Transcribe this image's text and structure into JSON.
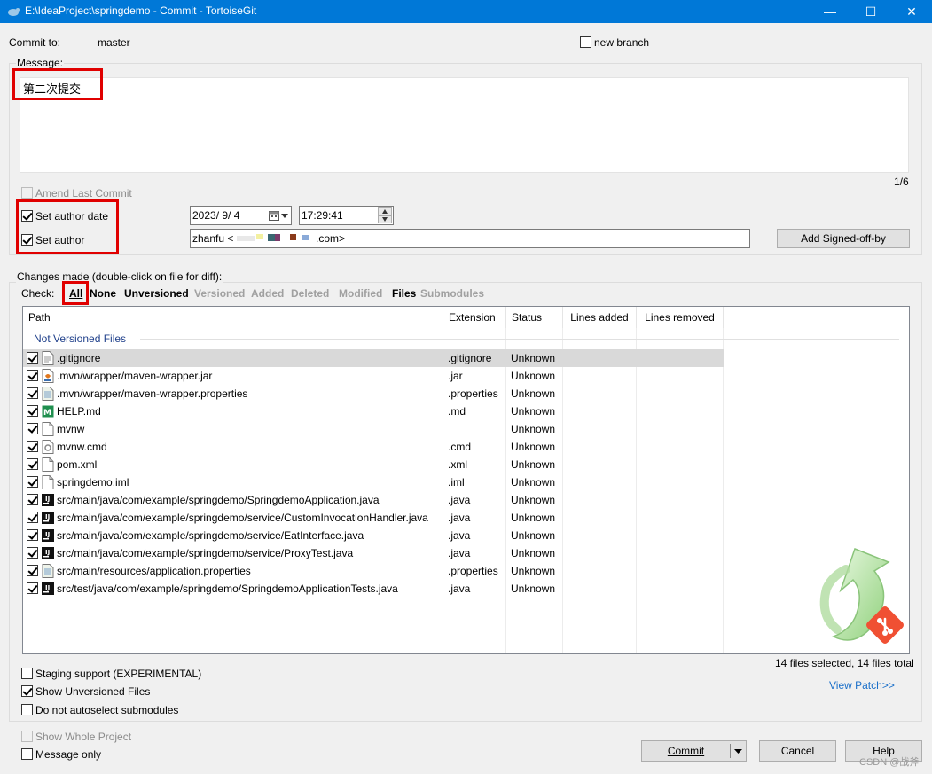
{
  "window": {
    "title": "E:\\IdeaProject\\springdemo - Commit - TortoiseGit",
    "minimize_glyph": "—",
    "maximize_glyph": "☐",
    "close_glyph": "✕"
  },
  "header": {
    "commit_to_label": "Commit to:",
    "branch": "master",
    "new_branch_label": "new branch"
  },
  "message": {
    "label": "Message:",
    "text": "第二次提交",
    "counter": "1/6"
  },
  "author": {
    "amend_label": "Amend Last Commit",
    "set_author_date_label": "Set author date",
    "set_author_label": "Set author",
    "date": "2023/  9/  4",
    "time": "17:29:41",
    "author_value": "zhanfu <",
    "author_suffix": ".com>",
    "signed_off_button": "Add Signed-off-by"
  },
  "changes": {
    "label": "Changes made (double-click on file for diff):",
    "check_label": "Check:",
    "filters": [
      {
        "label": "All",
        "active": true
      },
      {
        "label": "None",
        "active": true
      },
      {
        "label": "Unversioned",
        "active": true
      },
      {
        "label": "Versioned",
        "active": false
      },
      {
        "label": "Added",
        "active": false
      },
      {
        "label": "Deleted",
        "active": false
      },
      {
        "label": "Modified",
        "active": false
      },
      {
        "label": "Files",
        "active": true
      },
      {
        "label": "Submodules",
        "active": false
      }
    ],
    "columns": [
      "Path",
      "Extension",
      "Status",
      "Lines added",
      "Lines removed"
    ],
    "group_label": "Not Versioned Files",
    "files": [
      {
        "path": ".gitignore",
        "ext": ".gitignore",
        "status": "Unknown",
        "icon": "text-file-icon"
      },
      {
        "path": ".mvn/wrapper/maven-wrapper.jar",
        "ext": ".jar",
        "status": "Unknown",
        "icon": "jar-file-icon"
      },
      {
        "path": ".mvn/wrapper/maven-wrapper.properties",
        "ext": ".properties",
        "status": "Unknown",
        "icon": "properties-file-icon"
      },
      {
        "path": "HELP.md",
        "ext": ".md",
        "status": "Unknown",
        "icon": "markdown-file-icon"
      },
      {
        "path": "mvnw",
        "ext": "",
        "status": "Unknown",
        "icon": "blank-file-icon"
      },
      {
        "path": "mvnw.cmd",
        "ext": ".cmd",
        "status": "Unknown",
        "icon": "cmd-file-icon"
      },
      {
        "path": "pom.xml",
        "ext": ".xml",
        "status": "Unknown",
        "icon": "blank-file-icon"
      },
      {
        "path": "springdemo.iml",
        "ext": ".iml",
        "status": "Unknown",
        "icon": "blank-file-icon"
      },
      {
        "path": "src/main/java/com/example/springdemo/SpringdemoApplication.java",
        "ext": ".java",
        "status": "Unknown",
        "icon": "intellij-file-icon"
      },
      {
        "path": "src/main/java/com/example/springdemo/service/CustomInvocationHandler.java",
        "ext": ".java",
        "status": "Unknown",
        "icon": "intellij-file-icon"
      },
      {
        "path": "src/main/java/com/example/springdemo/service/EatInterface.java",
        "ext": ".java",
        "status": "Unknown",
        "icon": "intellij-file-icon"
      },
      {
        "path": "src/main/java/com/example/springdemo/service/ProxyTest.java",
        "ext": ".java",
        "status": "Unknown",
        "icon": "intellij-file-icon"
      },
      {
        "path": "src/main/resources/application.properties",
        "ext": ".properties",
        "status": "Unknown",
        "icon": "properties-file-icon"
      },
      {
        "path": "src/test/java/com/example/springdemo/SpringdemoApplicationTests.java",
        "ext": ".java",
        "status": "Unknown",
        "icon": "intellij-file-icon"
      }
    ],
    "summary": "14 files selected, 14 files total",
    "view_patch": "View Patch>>"
  },
  "options": {
    "staging_support": "Staging support (EXPERIMENTAL)",
    "show_unversioned": "Show Unversioned Files",
    "no_autoselect": "Do not autoselect submodules",
    "show_whole_project": "Show Whole Project",
    "message_only": "Message only"
  },
  "buttons": {
    "commit": "Commit",
    "cancel": "Cancel",
    "help": "Help"
  },
  "watermark": "CSDN @战斧",
  "colors": {
    "titlebar": "#0078d7",
    "highlight_box": "#e00000",
    "link": "#1a6fc9"
  }
}
